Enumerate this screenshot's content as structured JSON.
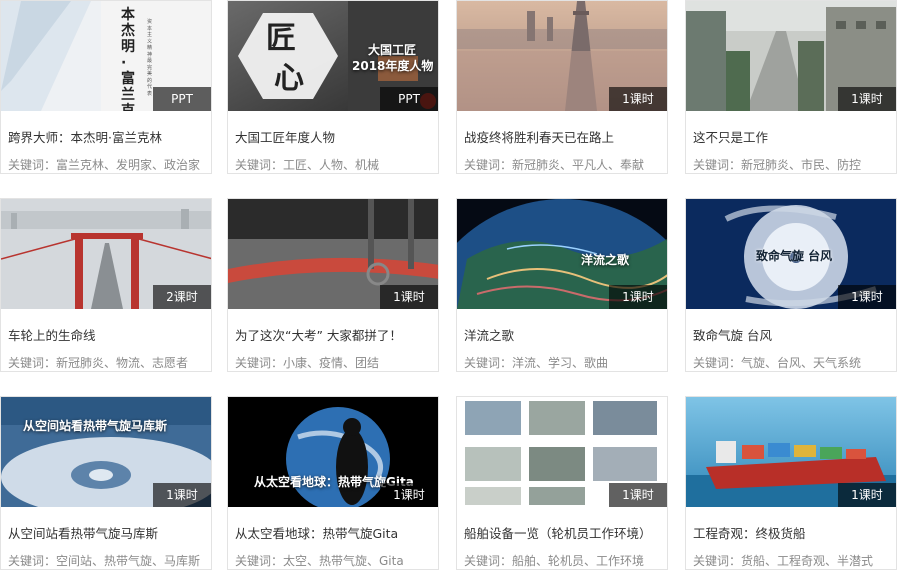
{
  "cards": [
    {
      "title": "跨界大师：本杰明·富兰克林",
      "keywords": "关键词：富兰克林、发明家、政治家",
      "badge": "PPT",
      "overlay": "本杰明·富兰克林",
      "overlay_sub": "资本主义精神最完美的代表",
      "icon": "book-cover-image"
    },
    {
      "title": "大国工匠年度人物",
      "keywords": "关键词：工匠、人物、机械",
      "badge": "PPT",
      "overlay": "大国工匠",
      "overlay_sub": "2018年度人物",
      "overlay_char1": "匠",
      "overlay_char2": "心",
      "icon": "craftsman-image"
    },
    {
      "title": "战疫终将胜利春天已在路上",
      "keywords": "关键词：新冠肺炎、平凡人、奉献",
      "badge": "1课时",
      "icon": "bridge-city-image"
    },
    {
      "title": "这不只是工作",
      "keywords": "关键词：新冠肺炎、市民、防控",
      "badge": "1课时",
      "icon": "empty-street-image"
    },
    {
      "title": "车轮上的生命线",
      "keywords": "关键词：新冠肺炎、物流、志愿者",
      "badge": "2课时",
      "icon": "foggy-bridge-image"
    },
    {
      "title": "为了这次“大考” 大家都拼了！",
      "keywords": "关键词：小康、疫情、团结",
      "badge": "1课时",
      "icon": "hospital-floor-image"
    },
    {
      "title": "洋流之歌",
      "keywords": "关键词：洋流、学习、歌曲",
      "badge": "1课时",
      "overlay": "洋流之歌",
      "icon": "ocean-current-globe-image"
    },
    {
      "title": "致命气旋 台风",
      "keywords": "关键词：气旋、台风、天气系统",
      "badge": "1课时",
      "overlay": "致命气旋 台风",
      "icon": "typhoon-satellite-image"
    },
    {
      "title": "从空间站看热带气旋马库斯",
      "keywords": "关键词：空间站、热带气旋、马库斯",
      "badge": "1课时",
      "overlay": "从空间站看热带气旋马库斯",
      "icon": "cyclone-from-space-image"
    },
    {
      "title": "从太空看地球：热带气旋Gita",
      "keywords": "关键词：太空、热带气旋、Gita",
      "badge": "1课时",
      "overlay": "从太空看地球：热带气旋Gita",
      "icon": "earth-silhouette-image"
    },
    {
      "title": "船舶设备一览（轮机员工作环境）",
      "keywords": "关键词：船舶、轮机员、工作环境",
      "badge": "1课时",
      "icon": "ship-equipment-collage-image"
    },
    {
      "title": "工程奇观：终极货船",
      "keywords": "关键词：货船、工程奇观、半潜式",
      "badge": "1课时",
      "icon": "cargo-ship-image"
    }
  ]
}
